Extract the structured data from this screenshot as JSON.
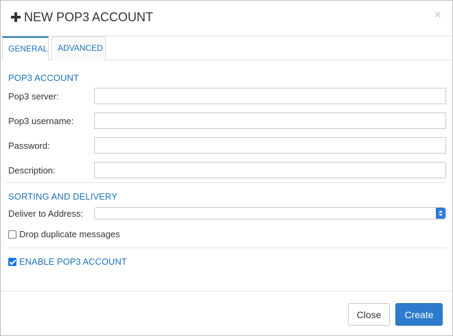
{
  "dialog": {
    "title": "NEW POP3 ACCOUNT",
    "close_glyph": "×"
  },
  "tabs": [
    {
      "label": "GENERAL",
      "active": true
    },
    {
      "label": "ADVANCED",
      "active": false
    }
  ],
  "pop3_section": {
    "heading": "POP3 ACCOUNT",
    "fields": {
      "server": {
        "label": "Pop3 server:",
        "value": ""
      },
      "username": {
        "label": "Pop3 username:",
        "value": ""
      },
      "password": {
        "label": "Password:",
        "value": ""
      },
      "description": {
        "label": "Description:",
        "value": ""
      }
    }
  },
  "sorting_section": {
    "heading": "SORTING AND DELIVERY",
    "deliver_label": "Deliver to Address:",
    "deliver_value": "",
    "drop_duplicates_label": "Drop duplicate messages",
    "drop_duplicates_checked": false
  },
  "enable": {
    "label": "ENABLE POP3 ACCOUNT",
    "checked": true
  },
  "footer": {
    "close_label": "Close",
    "create_label": "Create"
  },
  "colors": {
    "accent": "#1a73b8",
    "primary_button": "#2d7bcc"
  }
}
